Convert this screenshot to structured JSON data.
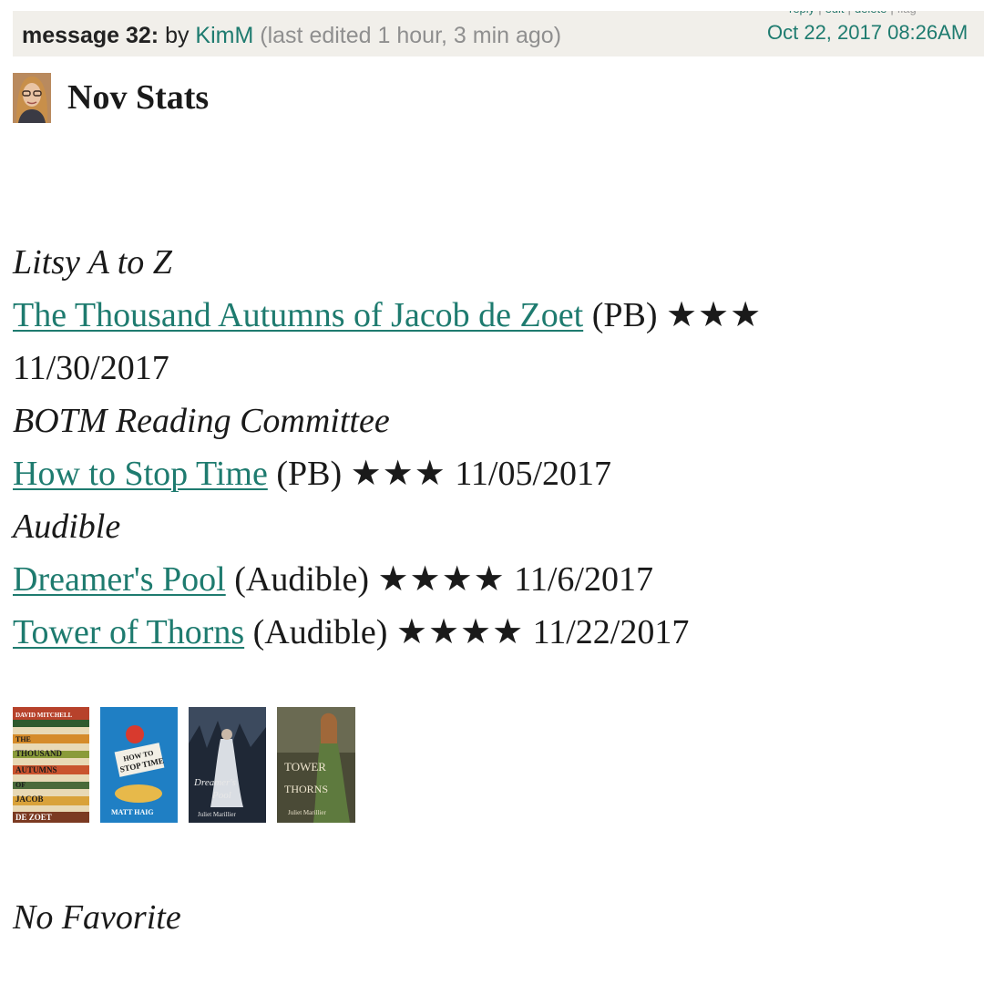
{
  "header": {
    "actions": [
      "reply",
      "edit",
      "delete",
      "flag"
    ],
    "message_label": "message 32:",
    "by": "by",
    "author": "KimM",
    "edited": "(last edited 1 hour, 3 min ago)",
    "date": "Oct 22, 2017 08:26AM"
  },
  "post": {
    "title": "Nov Stats"
  },
  "sections": [
    {
      "category": "Litsy A to Z",
      "books": [
        {
          "title": "The Thousand Autumns of Jacob de Zoet",
          "format": "(PB)",
          "stars": "★★★",
          "date": "11/30/2017"
        }
      ]
    },
    {
      "category": "BOTM Reading Committee",
      "books": [
        {
          "title": "How to Stop Time",
          "format": "(PB)",
          "stars": "★★★",
          "date": "11/05/2017"
        }
      ]
    },
    {
      "category": "Audible",
      "books": [
        {
          "title": "Dreamer's Pool",
          "format": "(Audible)",
          "stars": "★★★★",
          "date": "11/6/2017"
        },
        {
          "title": "Tower of Thorns",
          "format": "(Audible)",
          "stars": "★★★★",
          "date": "11/22/2017"
        }
      ]
    }
  ],
  "covers": [
    {
      "title": "The Thousand Autumns of Jacob de Zoet",
      "lines": [
        "DAVID MITCHELL",
        "THE",
        "THOUSAND",
        "AUTUMNS",
        "OF",
        "JACOB",
        "DE ZOET"
      ]
    },
    {
      "title": "How to Stop Time",
      "lines": [
        "HOW TO",
        "STOP TIME",
        "MATT HAIG"
      ]
    },
    {
      "title": "Dreamer's Pool",
      "lines": [
        "Dreamer's",
        "Pool",
        "Juliet Marillier"
      ]
    },
    {
      "title": "Tower of Thorns",
      "lines": [
        "TOWER",
        "THORNS",
        "Juliet Marillier"
      ]
    }
  ],
  "footer": {
    "note": "No Favorite"
  },
  "colors": {
    "link": "#1e7b6f",
    "header_bg": "#f1efea",
    "muted": "#8f8f8f"
  }
}
